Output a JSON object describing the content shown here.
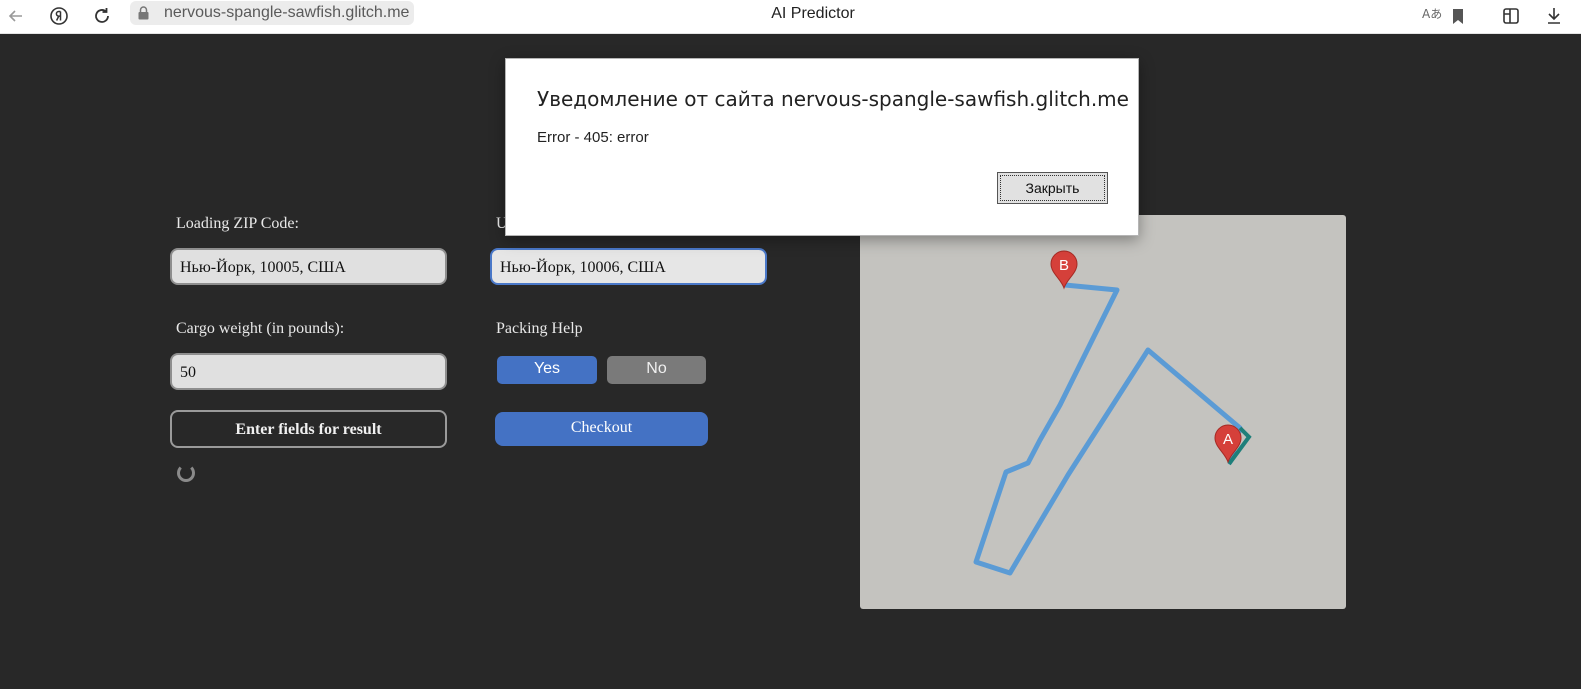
{
  "browser": {
    "url": "nervous-spangle-sawfish.glitch.me",
    "tab_title": "AI Predictor",
    "translate_glyph": "Aあ"
  },
  "form": {
    "loading_zip_label": "Loading ZIP Code:",
    "loading_zip_value": "Нью-Йорк, 10005, США",
    "unloading_zip_label": "U",
    "unloading_zip_value": "Нью-Йорк, 10006, США",
    "cargo_weight_label": "Cargo weight (in pounds):",
    "cargo_weight_value": "50",
    "packing_help_label": "Packing Help",
    "packing_yes": "Yes",
    "packing_no": "No",
    "result_button": "Enter fields for result",
    "checkout_button": "Checkout"
  },
  "map": {
    "marker_a": "A",
    "marker_b": "B",
    "route_color": "#5b9bd5",
    "marker_color": "#d5403a",
    "background_color": "#c4c3bf"
  },
  "dialog": {
    "title": "Уведомление от сайта nervous-spangle-sawfish.glitch.me",
    "message": "Error - 405: error",
    "close_button": "Закрыть"
  },
  "colors": {
    "page_background": "#282828",
    "accent": "#4472c4",
    "no_button": "#7a7a7a"
  }
}
